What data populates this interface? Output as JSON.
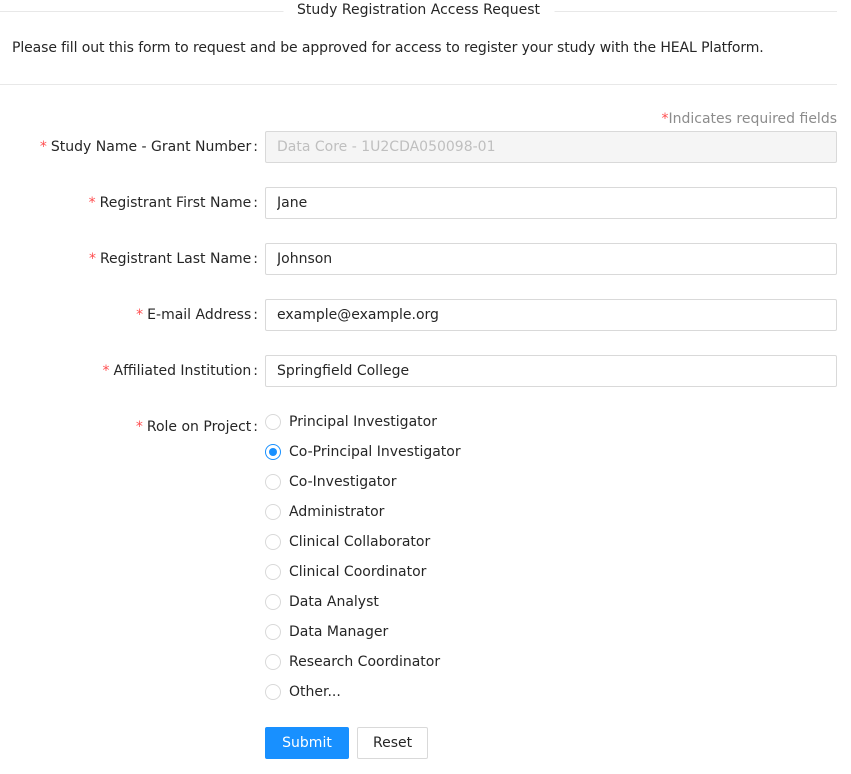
{
  "header": {
    "title": "Study Registration Access Request",
    "intro": "Please fill out this form to request and be approved for access to register your study with the HEAL Platform."
  },
  "required_note": {
    "star": "*",
    "text": "Indicates required fields"
  },
  "fields": {
    "study_name": {
      "label": "Study Name - Grant Number",
      "value": "Data Core - 1U2CDA050098-01",
      "disabled": true
    },
    "first_name": {
      "label": "Registrant First Name",
      "value": "Jane"
    },
    "last_name": {
      "label": "Registrant Last Name",
      "value": "Johnson"
    },
    "email": {
      "label": "E-mail Address",
      "value": "example@example.org"
    },
    "institution": {
      "label": "Affiliated Institution",
      "value": "Springfield College"
    }
  },
  "role": {
    "label": "Role on Project",
    "selected": "Co-Principal Investigator",
    "options": [
      "Principal Investigator",
      "Co-Principal Investigator",
      "Co-Investigator",
      "Administrator",
      "Clinical Collaborator",
      "Clinical Coordinator",
      "Data Analyst",
      "Data Manager",
      "Research Coordinator",
      "Other..."
    ]
  },
  "buttons": {
    "submit": "Submit",
    "reset": "Reset"
  },
  "colors": {
    "primary": "#1890ff",
    "required": "#ff4d4f"
  },
  "label_suffix": ":",
  "required_star": "*"
}
